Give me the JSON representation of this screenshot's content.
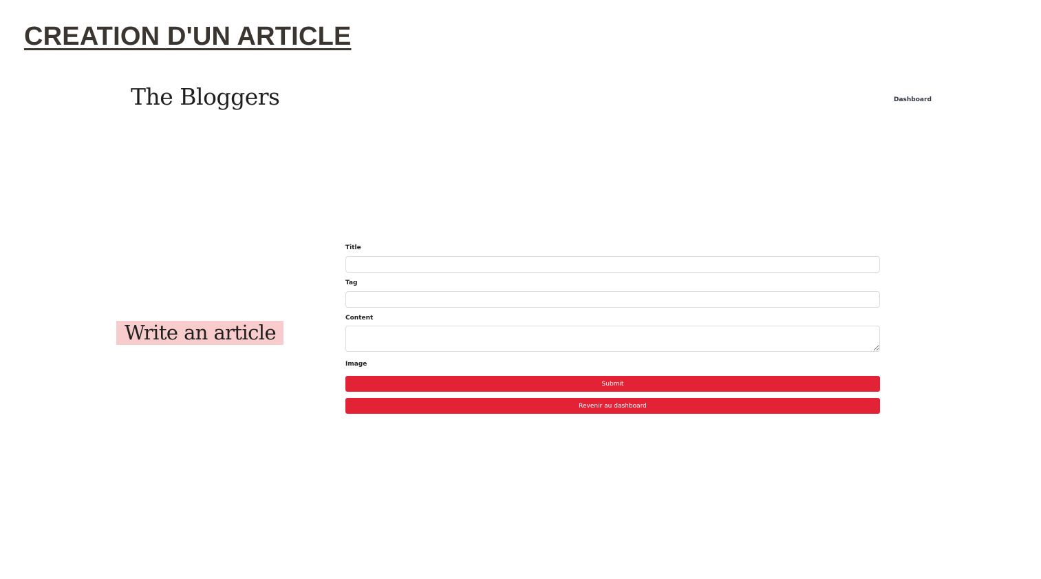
{
  "slide": {
    "heading": "CREATION D'UN ARTICLE"
  },
  "header": {
    "brand": "The Bloggers",
    "nav": {
      "dashboard": "Dashboard"
    }
  },
  "main": {
    "heading": "Write an article",
    "heading_highlight_color": "#f8cccc"
  },
  "form": {
    "fields": {
      "title": {
        "label": "Title",
        "value": ""
      },
      "tag": {
        "label": "Tag",
        "value": ""
      },
      "content": {
        "label": "Content",
        "value": ""
      },
      "image": {
        "label": "Image"
      }
    },
    "buttons": {
      "submit": "Submit",
      "back": "Revenir au dashboard"
    },
    "button_color": "#e32236"
  }
}
